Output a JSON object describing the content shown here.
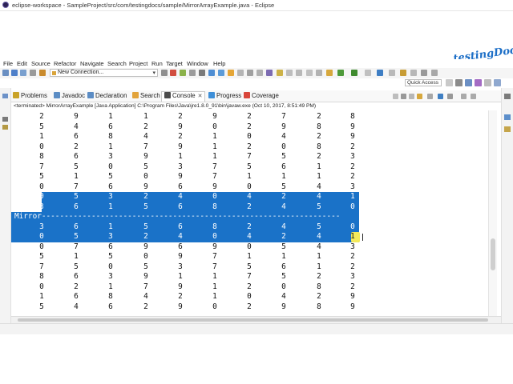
{
  "window": {
    "title": "eclipse-workspace - SampleProject/src/com/testingdocs/sample/MirrorArrayExample.java - Eclipse"
  },
  "logo_text": "testingDocs.com",
  "menu": [
    "File",
    "Edit",
    "Source",
    "Refactor",
    "Navigate",
    "Search",
    "Project",
    "Run",
    "Target",
    "Window",
    "Help"
  ],
  "toolbar": {
    "connection_label": "New Connection..."
  },
  "quick_access": "Quick Access",
  "tabs": [
    {
      "label": "Problems",
      "icon": "problems-icon",
      "color": "#c9a227"
    },
    {
      "label": "Javadoc",
      "icon": "javadoc-icon",
      "color": "#5b8cc4"
    },
    {
      "label": "Declaration",
      "icon": "declaration-icon",
      "color": "#5b8cc4"
    },
    {
      "label": "Search",
      "icon": "search-icon",
      "color": "#e2a33b"
    },
    {
      "label": "Console",
      "icon": "console-icon",
      "color": "#4b4b4b",
      "close": "✕"
    },
    {
      "label": "Progress",
      "icon": "progress-icon",
      "color": "#3e8fd8"
    },
    {
      "label": "Coverage",
      "icon": "coverage-icon",
      "color": "#d9463b"
    }
  ],
  "console": {
    "status": "<terminated> MirrorArrayExample [Java Application] C:\\Program Files\\Java\\jre1.8.0_91\\bin\\javaw.exe (Oct 10, 2017, 8:51:49 PM)",
    "mirror_label": "Mirror",
    "selection_color": "#1a72c8",
    "rows_before": [
      [
        "2",
        "9",
        "1",
        "1",
        "2",
        "9",
        "2",
        "7",
        "2",
        "8"
      ],
      [
        "5",
        "4",
        "6",
        "2",
        "9",
        "0",
        "2",
        "9",
        "8",
        "9"
      ],
      [
        "1",
        "6",
        "8",
        "4",
        "2",
        "1",
        "0",
        "4",
        "2",
        "9"
      ],
      [
        "0",
        "2",
        "1",
        "7",
        "9",
        "1",
        "2",
        "0",
        "8",
        "2"
      ],
      [
        "8",
        "6",
        "3",
        "9",
        "1",
        "1",
        "7",
        "5",
        "2",
        "3"
      ],
      [
        "7",
        "5",
        "0",
        "5",
        "3",
        "7",
        "5",
        "6",
        "1",
        "2"
      ],
      [
        "5",
        "1",
        "5",
        "0",
        "9",
        "7",
        "1",
        "1",
        "1",
        "2"
      ],
      [
        "0",
        "7",
        "6",
        "9",
        "6",
        "9",
        "0",
        "5",
        "4",
        "3"
      ]
    ],
    "rows_selected_top": [
      [
        "0",
        "5",
        "3",
        "2",
        "4",
        "0",
        "4",
        "2",
        "4",
        "1"
      ],
      [
        "3",
        "6",
        "1",
        "5",
        "6",
        "8",
        "2",
        "4",
        "5",
        "0"
      ]
    ],
    "rows_selected_bottom": [
      [
        "3",
        "6",
        "1",
        "5",
        "6",
        "8",
        "2",
        "4",
        "5",
        "0"
      ],
      [
        "0",
        "5",
        "3",
        "2",
        "4",
        "0",
        "4",
        "2",
        "4",
        "1"
      ]
    ],
    "rows_after": [
      [
        "0",
        "7",
        "6",
        "9",
        "6",
        "9",
        "0",
        "5",
        "4",
        "3"
      ],
      [
        "5",
        "1",
        "5",
        "0",
        "9",
        "7",
        "1",
        "1",
        "1",
        "2"
      ],
      [
        "7",
        "5",
        "0",
        "5",
        "3",
        "7",
        "5",
        "6",
        "1",
        "2"
      ],
      [
        "8",
        "6",
        "3",
        "9",
        "1",
        "1",
        "7",
        "5",
        "2",
        "3"
      ],
      [
        "0",
        "2",
        "1",
        "7",
        "9",
        "1",
        "2",
        "0",
        "8",
        "2"
      ],
      [
        "1",
        "6",
        "8",
        "4",
        "2",
        "1",
        "0",
        "4",
        "2",
        "9"
      ],
      [
        "5",
        "4",
        "6",
        "2",
        "9",
        "0",
        "2",
        "9",
        "8",
        "9"
      ]
    ]
  }
}
